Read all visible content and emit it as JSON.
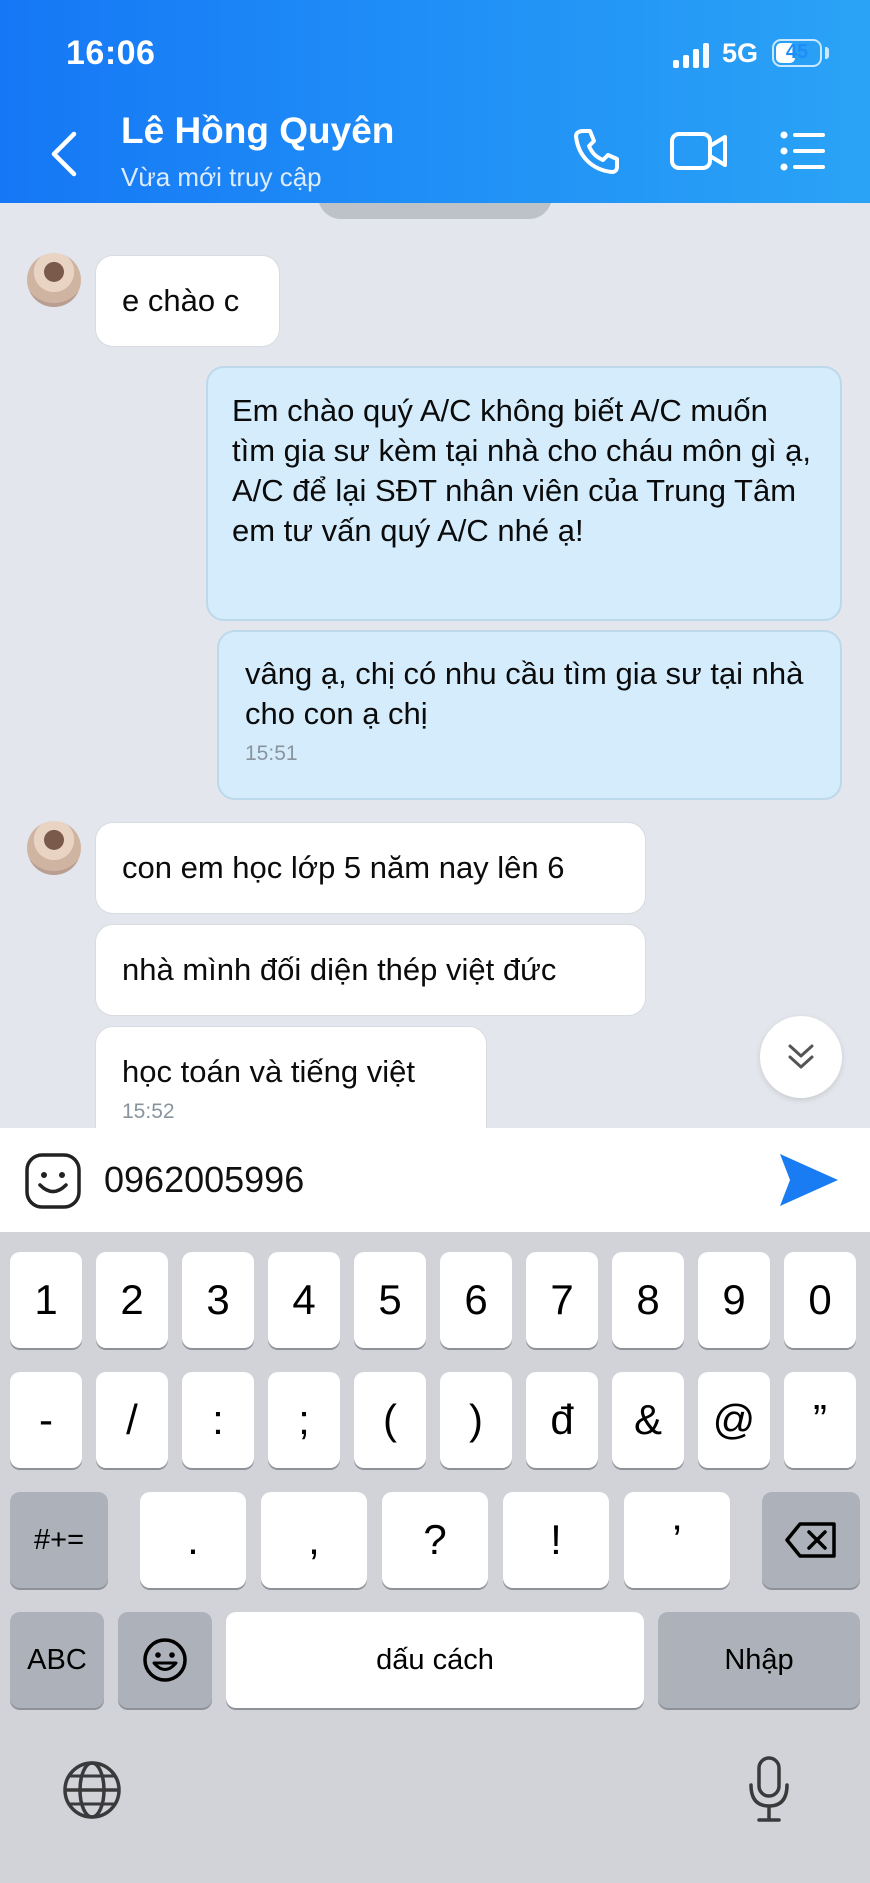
{
  "status_bar": {
    "time": "16:06",
    "network": "5G",
    "battery": "45",
    "battery_level": 0.45
  },
  "header": {
    "contact_name": "Lê Hồng Quyên",
    "presence": "Vừa mới truy cập"
  },
  "messages": [
    {
      "side": "in",
      "text": "e chào c"
    },
    {
      "side": "out",
      "text": "Em chào quý A/C không biết A/C muốn tìm gia sư kèm tại nhà cho cháu môn gì ạ, A/C để lại SĐT nhân viên của Trung Tâm em tư vấn quý A/C nhé ạ!"
    },
    {
      "side": "out",
      "text": "vâng ạ, chị có nhu cầu tìm gia sư tại nhà cho con ạ chị",
      "time": "15:51"
    },
    {
      "side": "in",
      "text": "con em học lớp 5 năm nay lên 6"
    },
    {
      "side": "in",
      "text": "nhà mình đối diện thép việt đức"
    },
    {
      "side": "in",
      "text": "học toán và tiếng việt",
      "time": "15:52"
    }
  ],
  "composer": {
    "value": "0962005996"
  },
  "keyboard": {
    "row1": [
      "1",
      "2",
      "3",
      "4",
      "5",
      "6",
      "7",
      "8",
      "9",
      "0"
    ],
    "row2": [
      "-",
      "/",
      ":",
      ";",
      "(",
      ")",
      "đ",
      "&",
      "@",
      "”"
    ],
    "row3_mode": "#+=",
    "row3": [
      ".",
      ",",
      "?",
      "!",
      "’"
    ],
    "abc": "ABC",
    "space": "dấu cách",
    "return": "Nhập"
  },
  "icons": {
    "back": "chevron-left-icon",
    "call": "phone-icon",
    "video": "video-camera-icon",
    "menu": "list-menu-icon",
    "sticker": "sticker-smile-icon",
    "send": "send-arrow-icon",
    "scroll": "double-chevron-down-icon",
    "delete": "backspace-icon",
    "emoji": "emoji-icon",
    "globe": "globe-icon",
    "mic": "microphone-icon"
  },
  "colors": {
    "header_start": "#1577f5",
    "header_end": "#2aa3f6",
    "outgoing_bubble": "#d4ecfb",
    "incoming_bubble": "#ffffff",
    "send": "#1a7cf2"
  }
}
